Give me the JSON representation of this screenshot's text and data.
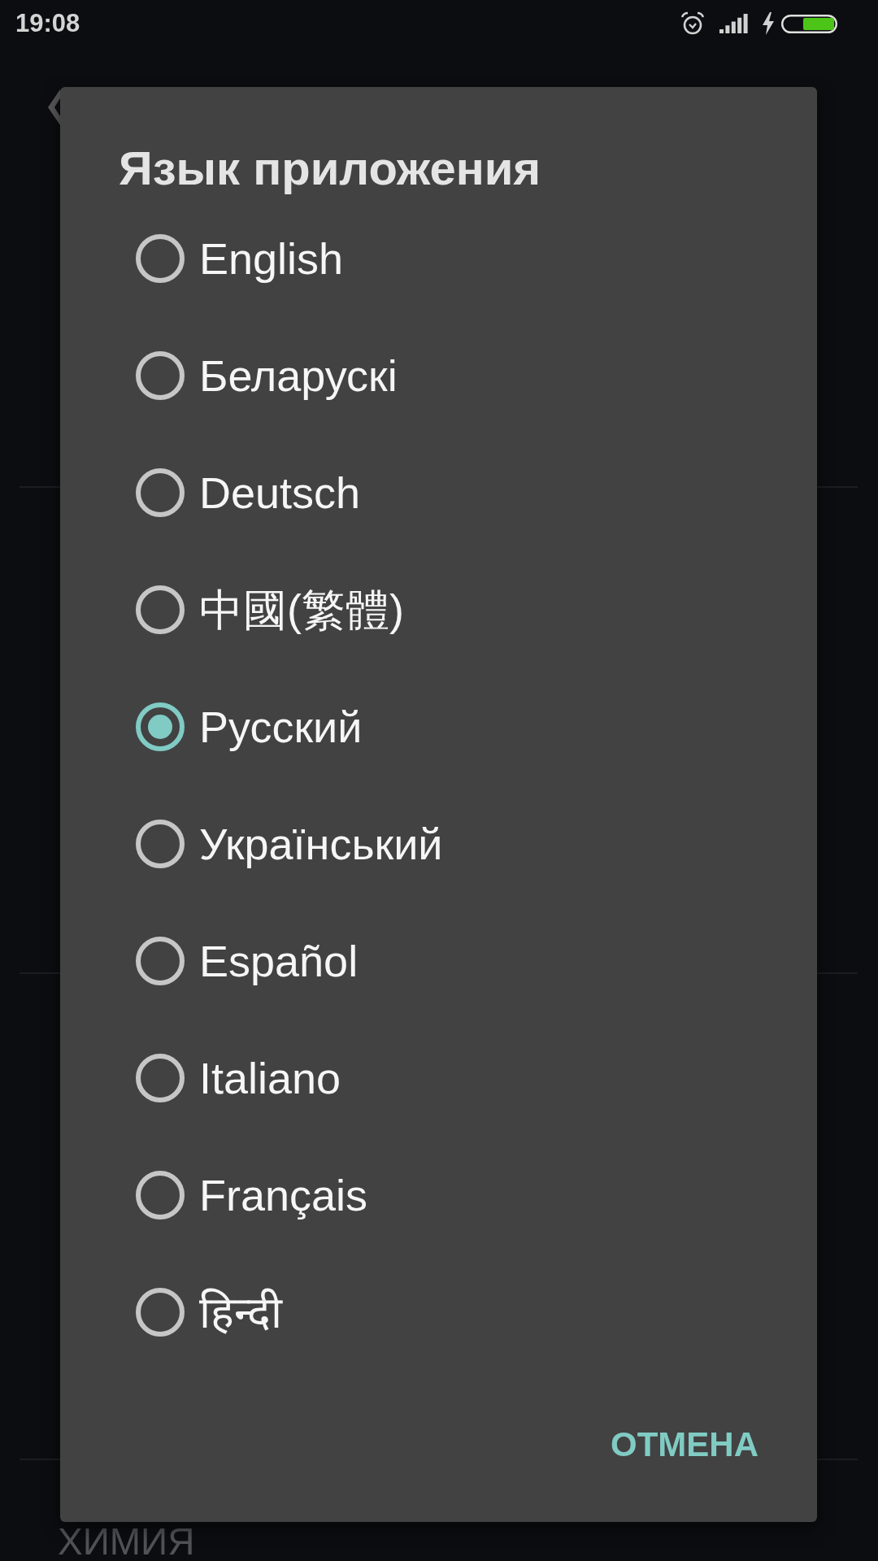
{
  "status_bar": {
    "time": "19:08"
  },
  "background_screen": {
    "list_heading": "ХИМИЯ"
  },
  "dialog": {
    "title": "Язык приложения",
    "options": [
      {
        "label": "English",
        "selected": false
      },
      {
        "label": "Беларускі",
        "selected": false
      },
      {
        "label": "Deutsch",
        "selected": false
      },
      {
        "label": "中國(繁體)",
        "selected": false
      },
      {
        "label": "Русский",
        "selected": true
      },
      {
        "label": "Український",
        "selected": false
      },
      {
        "label": "Español",
        "selected": false
      },
      {
        "label": "Italiano",
        "selected": false
      },
      {
        "label": "Français",
        "selected": false
      },
      {
        "label": "हिन्दी",
        "selected": false
      }
    ],
    "buttons": [
      {
        "label": "ОТМЕНА"
      }
    ]
  }
}
